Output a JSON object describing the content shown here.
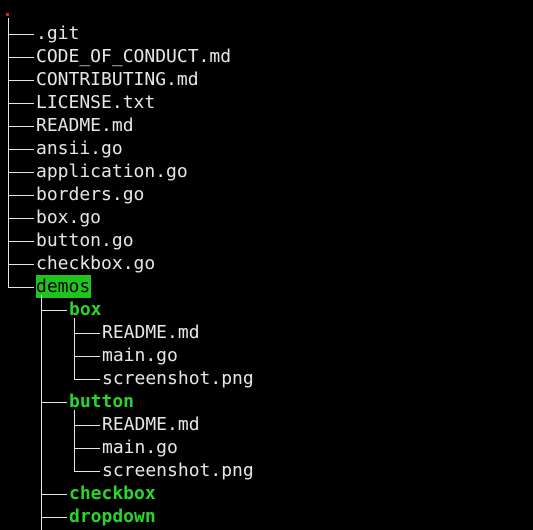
{
  "colors": {
    "background": "#000000",
    "file_text": "#e6e6e6",
    "directory_text": "#2ad42a",
    "selection_background": "#1fc41f",
    "selection_text": "#000000",
    "root_marker": "#e02020"
  },
  "tree": {
    "root_marker_icon": "red-dot",
    "entries": [
      {
        "label": ".git",
        "depth": 0,
        "type": "file"
      },
      {
        "label": "CODE_OF_CONDUCT.md",
        "depth": 0,
        "type": "file"
      },
      {
        "label": "CONTRIBUTING.md",
        "depth": 0,
        "type": "file"
      },
      {
        "label": "LICENSE.txt",
        "depth": 0,
        "type": "file"
      },
      {
        "label": "README.md",
        "depth": 0,
        "type": "file"
      },
      {
        "label": "ansii.go",
        "depth": 0,
        "type": "file"
      },
      {
        "label": "application.go",
        "depth": 0,
        "type": "file"
      },
      {
        "label": "borders.go",
        "depth": 0,
        "type": "file"
      },
      {
        "label": "box.go",
        "depth": 0,
        "type": "file"
      },
      {
        "label": "button.go",
        "depth": 0,
        "type": "file"
      },
      {
        "label": "checkbox.go",
        "depth": 0,
        "type": "file"
      },
      {
        "label": "demos",
        "depth": 0,
        "type": "dir",
        "selected": true
      },
      {
        "label": "box",
        "depth": 1,
        "type": "dir"
      },
      {
        "label": "README.md",
        "depth": 2,
        "type": "file"
      },
      {
        "label": "main.go",
        "depth": 2,
        "type": "file"
      },
      {
        "label": "screenshot.png",
        "depth": 2,
        "type": "file"
      },
      {
        "label": "button",
        "depth": 1,
        "type": "dir"
      },
      {
        "label": "README.md",
        "depth": 2,
        "type": "file"
      },
      {
        "label": "main.go",
        "depth": 2,
        "type": "file"
      },
      {
        "label": "screenshot.png",
        "depth": 2,
        "type": "file"
      },
      {
        "label": "checkbox",
        "depth": 1,
        "type": "dir"
      },
      {
        "label": "dropdown",
        "depth": 1,
        "type": "dir"
      }
    ]
  }
}
